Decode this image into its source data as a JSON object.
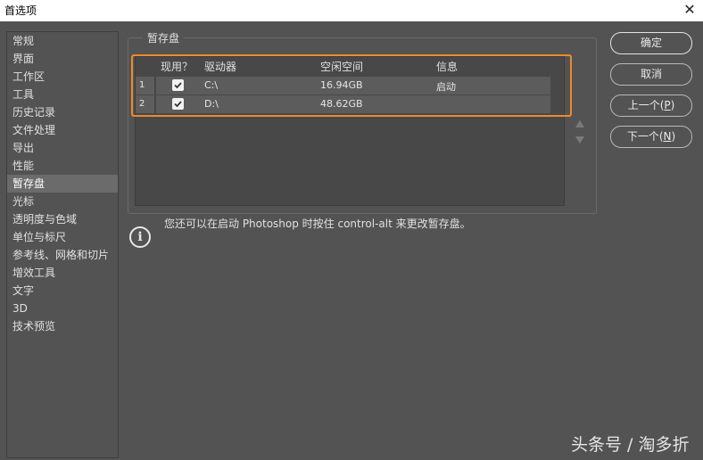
{
  "window": {
    "title": "首选项",
    "close_glyph": "✕"
  },
  "sidebar": {
    "items": [
      {
        "label": "常规"
      },
      {
        "label": "界面"
      },
      {
        "label": "工作区"
      },
      {
        "label": "工具"
      },
      {
        "label": "历史记录"
      },
      {
        "label": "文件处理"
      },
      {
        "label": "导出"
      },
      {
        "label": "性能"
      },
      {
        "label": "暂存盘",
        "selected": true
      },
      {
        "label": "光标"
      },
      {
        "label": "透明度与色域"
      },
      {
        "label": "单位与标尺"
      },
      {
        "label": "参考线、网格和切片"
      },
      {
        "label": "增效工具"
      },
      {
        "label": "文字"
      },
      {
        "label": "3D"
      },
      {
        "label": "技术预览"
      }
    ]
  },
  "scratch": {
    "legend": "暂存盘",
    "columns": {
      "active": "现用？",
      "drive": "驱动器",
      "free_space": "空闲空间",
      "info": "信息"
    },
    "rows": [
      {
        "num": "1",
        "checked": true,
        "drive": "C:\\",
        "free_space": "16.94GB",
        "info": "启动"
      },
      {
        "num": "2",
        "checked": true,
        "drive": "D:\\",
        "free_space": "48.62GB",
        "info": ""
      }
    ],
    "move_up_icon": "triangle-up-icon",
    "move_down_icon": "triangle-down-icon"
  },
  "info": {
    "icon": "info-icon",
    "icon_glyph": "i",
    "text": "您还可以在启动 Photoshop 时按住 control-alt 来更改暂存盘。"
  },
  "buttons": {
    "ok": "确定",
    "cancel": "取消",
    "prev": "上一个(",
    "prev_key": "P",
    "next": "下一个(",
    "next_key": "N",
    "close_paren": ")"
  },
  "watermark": "头条号 / 淘多折",
  "colors": {
    "highlight_border": "#f08a2c",
    "background": "#535353",
    "selected_item": "#6b6b6b"
  }
}
